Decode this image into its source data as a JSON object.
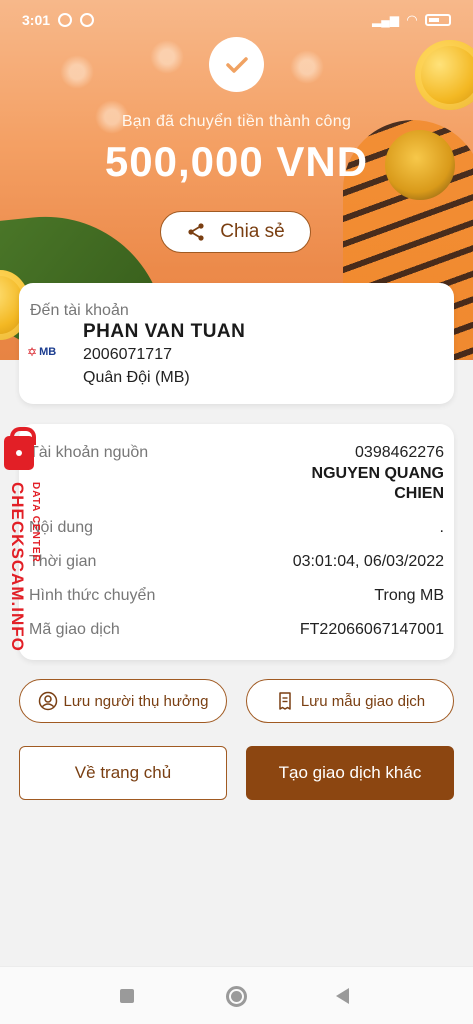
{
  "status_bar": {
    "time": "3:01"
  },
  "hero": {
    "success_message": "Bạn đã chuyển tiền thành công",
    "amount": "500,000 VND",
    "share_label": "Chia sẻ"
  },
  "recipient": {
    "label": "Đến tài khoản",
    "bank_logo_text": "MB",
    "name": "PHAN VAN TUAN",
    "account_number": "2006071717",
    "bank_name": "Quân Đội (MB)"
  },
  "details": {
    "source_label": "Tài khoản nguồn",
    "source_account": "0398462276",
    "source_name": "NGUYEN QUANG CHIEN",
    "content_label": "Nội dung",
    "content_value": ".",
    "time_label": "Thời gian",
    "time_value": "03:01:04, 06/03/2022",
    "method_label": "Hình thức chuyển",
    "method_value": "Trong MB",
    "txn_label": "Mã giao dịch",
    "txn_value": "FT22066067147001"
  },
  "watermark": {
    "main": "CHECKSCAM.INFO",
    "sub": "DATA CENTER"
  },
  "actions": {
    "save_recipient": "Lưu người thụ hưởng",
    "save_template": "Lưu mẫu giao dịch",
    "home": "Về trang chủ",
    "new_transaction": "Tạo giao dịch khác"
  },
  "colors": {
    "accent": "#8c4611",
    "hero": "#f4a064",
    "watermark": "#e21f26"
  }
}
